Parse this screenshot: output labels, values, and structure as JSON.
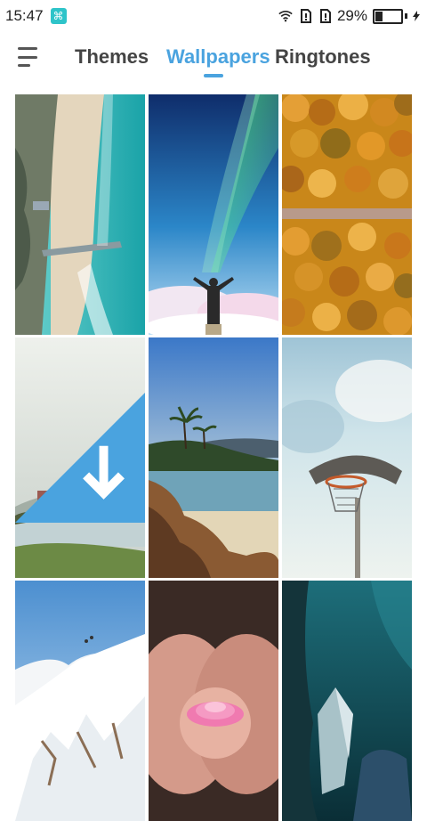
{
  "status": {
    "time": "15:47",
    "battery_percent": "29%",
    "battery_level": 0.29
  },
  "tabs": [
    {
      "label": "Themes",
      "active": false
    },
    {
      "label": "Wallpapers",
      "active": true
    },
    {
      "label": "Ringtones",
      "active": false
    }
  ],
  "colors": {
    "accent": "#4aa3df",
    "tab_inactive": "#444444"
  },
  "wallpapers": [
    {
      "name": "aerial-beach"
    },
    {
      "name": "aurora-person"
    },
    {
      "name": "autumn-forest"
    },
    {
      "name": "foggy-lake-house"
    },
    {
      "name": "rocky-coast-palms"
    },
    {
      "name": "basketball-hoop-sky"
    },
    {
      "name": "snowy-mountain"
    },
    {
      "name": "hands-with-flower"
    },
    {
      "name": "ice-cave"
    }
  ]
}
